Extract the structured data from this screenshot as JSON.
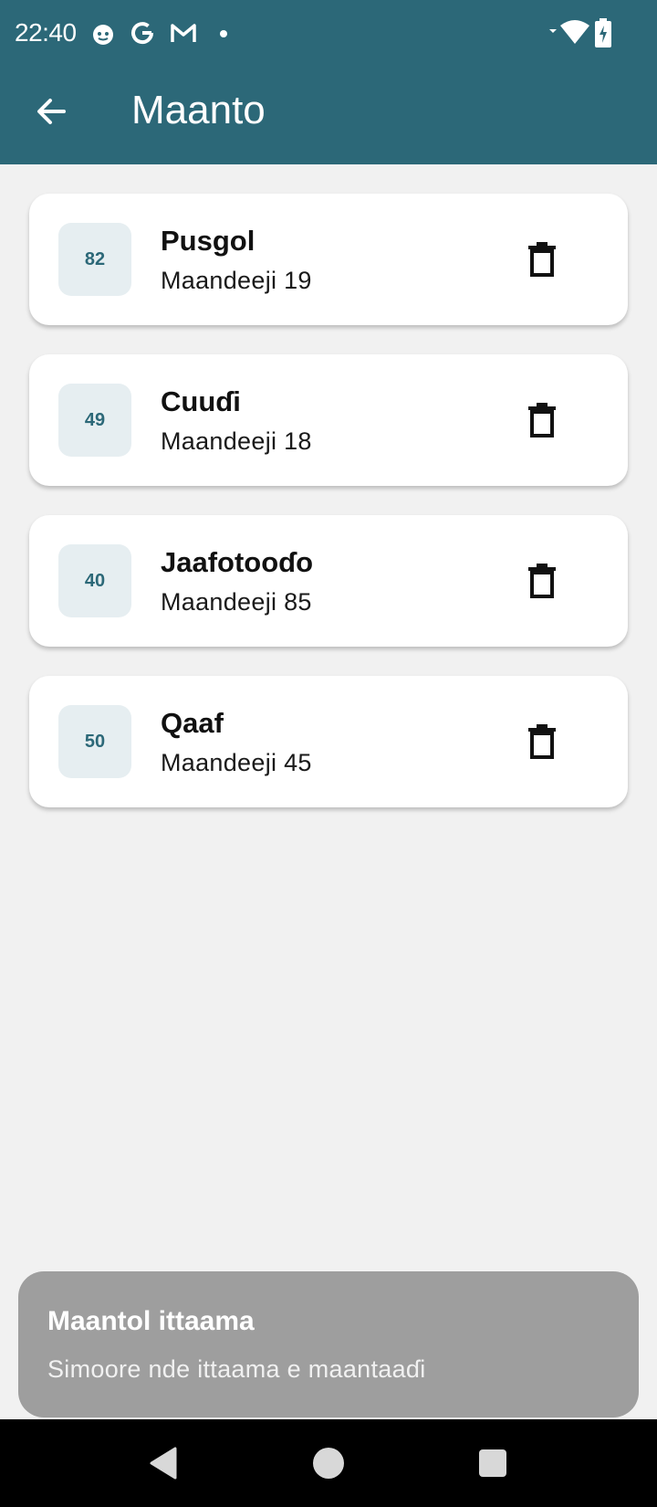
{
  "status_bar": {
    "time": "22:40",
    "icons": [
      "cat-face-icon",
      "google-g-icon",
      "gmail-icon",
      "dot-icon",
      "wifi-icon",
      "battery-charging-icon"
    ]
  },
  "app_bar": {
    "title": "Maanto",
    "back_icon": "arrow-left-icon",
    "color": "#2c6878"
  },
  "items": [
    {
      "number": "82",
      "title": "Pusgol",
      "subtitle": "Maandeeji 19"
    },
    {
      "number": "49",
      "title": "Cuuɗi",
      "subtitle": "Maandeeji 18"
    },
    {
      "number": "40",
      "title": "Jaafotooɗo",
      "subtitle": "Maandeeji 85"
    },
    {
      "number": "50",
      "title": "Qaaf",
      "subtitle": "Maandeeji 45"
    }
  ],
  "snackbar": {
    "title": "Maantol ittaama",
    "message": "Simoore nde ittaama e maantaaɗi"
  },
  "nav_bar": {
    "icons": [
      "back-triangle-icon",
      "home-circle-icon",
      "recents-square-icon"
    ]
  }
}
